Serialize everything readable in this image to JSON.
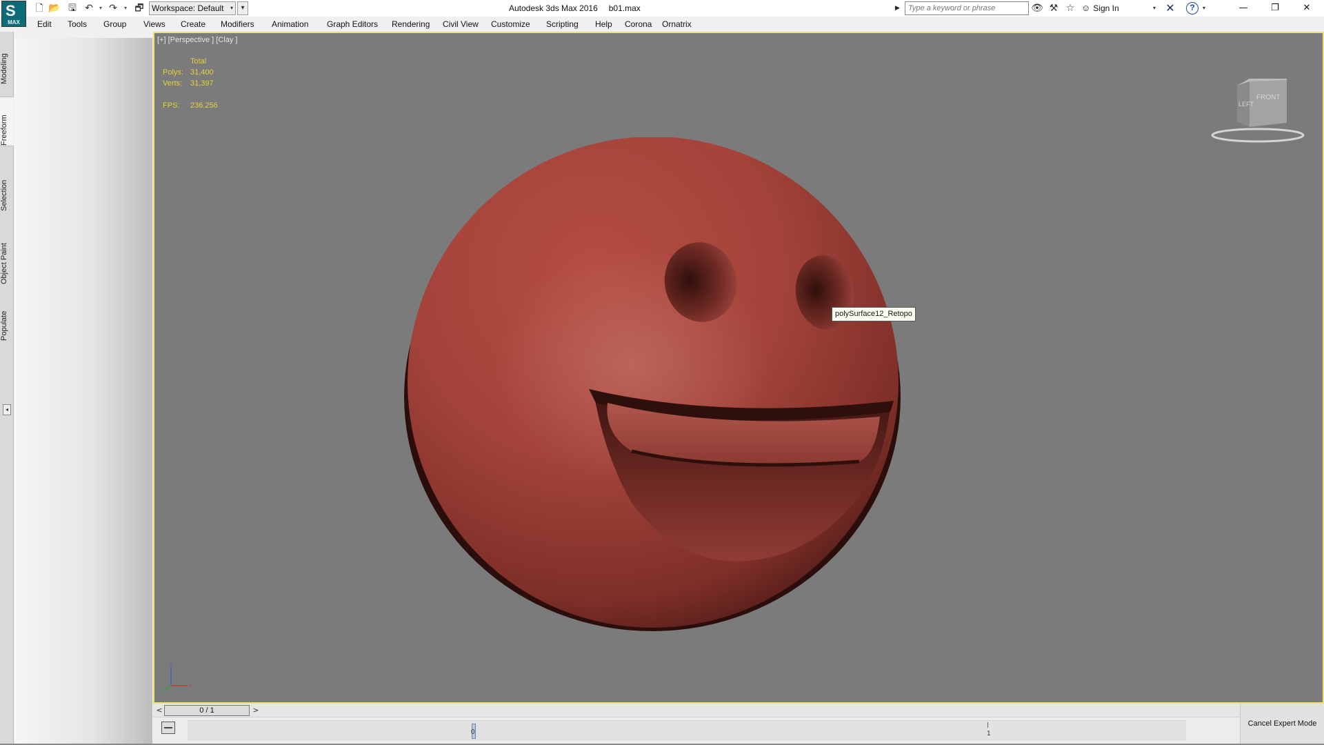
{
  "app": {
    "logo_label": "MAX",
    "title": "Autodesk 3ds Max 2016",
    "file_name": "b01.max"
  },
  "quick_access": {
    "workspace_label": "Workspace: Default"
  },
  "search": {
    "placeholder": "Type a keyword or phrase"
  },
  "account": {
    "sign_in_label": "Sign In"
  },
  "menu": {
    "items": [
      "Edit",
      "Tools",
      "Group",
      "Views",
      "Create",
      "Modifiers",
      "Animation",
      "Graph Editors",
      "Rendering",
      "Civil View",
      "Customize",
      "Scripting",
      "Help",
      "Corona",
      "Ornatrix"
    ]
  },
  "ribbon": {
    "tabs": [
      "Modeling",
      "Freeform",
      "Selection",
      "Object Paint",
      "Populate"
    ],
    "active_tab": "Freeform"
  },
  "viewport": {
    "label": "[+] [Perspective ] [Clay ]",
    "stats": {
      "header": "Total",
      "polys_label": "Polys:",
      "polys_value": "31,400",
      "verts_label": "Verts:",
      "verts_value": "31,397",
      "fps_label": "FPS:",
      "fps_value": "236.256"
    },
    "tooltip": "polySurface12_Retopo",
    "viewcube": {
      "left_face": "LEFT",
      "front_face": "FRONT"
    },
    "axis": {
      "x": "x",
      "y": "y",
      "z": "z"
    },
    "border_color": "#ece36a",
    "background_color": "#7b7b7b",
    "model_color": "#a8453c"
  },
  "timeline": {
    "slider_value": "0 / 1",
    "prev": "<",
    "next": ">",
    "key_label": "0",
    "end_label": "1"
  },
  "status": {
    "cancel_expert_label": "Cancel Expert Mode"
  }
}
